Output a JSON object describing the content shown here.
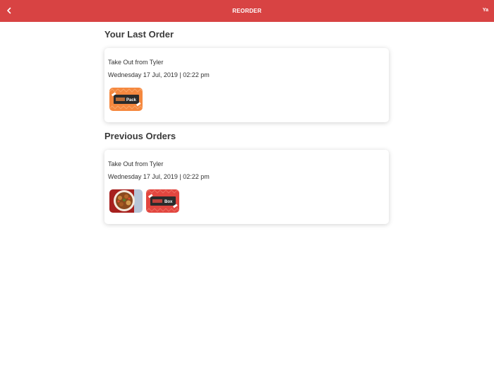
{
  "header": {
    "title": "REORDER",
    "user_initials": "Ya"
  },
  "last_order": {
    "section_title": "Your Last Order",
    "title": "Take Out from Tyler",
    "datetime": "Wednesday 17 Jul, 2019 | 02:22 pm",
    "items": [
      {
        "name": "Pack",
        "icon": "pack-box-image"
      }
    ]
  },
  "previous_orders": {
    "section_title": "Previous Orders",
    "orders": [
      {
        "title": "Take Out from Tyler",
        "datetime": "Wednesday 17 Jul, 2019 | 02:22 pm",
        "items": [
          {
            "name": "",
            "icon": "food-plate-image"
          },
          {
            "name": "Box",
            "icon": "box-image"
          }
        ]
      }
    ]
  },
  "colors": {
    "accent": "#d84343",
    "pack_orange": "#f5883f",
    "box_red": "#e2463f"
  }
}
